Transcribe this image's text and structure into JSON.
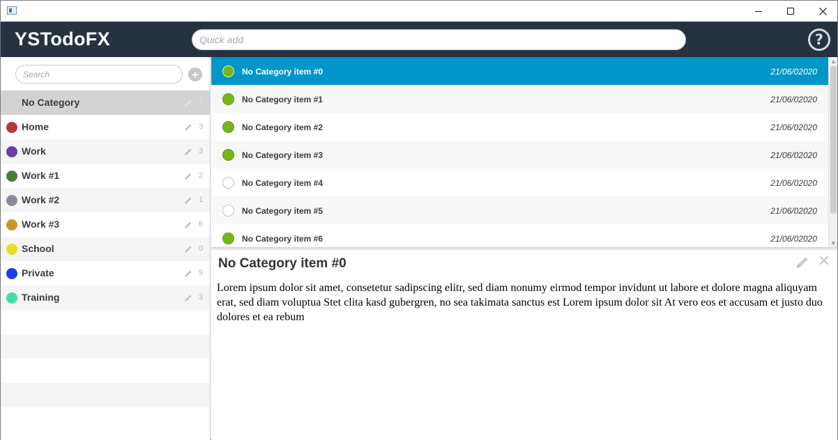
{
  "app": {
    "title": "YSTodoFX"
  },
  "quick_add": {
    "placeholder": "Quick add"
  },
  "help": {
    "label": "?"
  },
  "sidebar": {
    "search_placeholder": "Search",
    "add_label": "+",
    "categories": [
      {
        "label": "No Category",
        "count": "7",
        "color": "#d3d3d3",
        "selected": true
      },
      {
        "label": "Home",
        "count": "3",
        "color": "#b5393c"
      },
      {
        "label": "Work",
        "count": "3",
        "color": "#6a3fa8"
      },
      {
        "label": "Work #1",
        "count": "2",
        "color": "#4e7a3a"
      },
      {
        "label": "Work #2",
        "count": "1",
        "color": "#8c8a96"
      },
      {
        "label": "Work #3",
        "count": "6",
        "color": "#cf9426"
      },
      {
        "label": "School",
        "count": "0",
        "color": "#ecde1e"
      },
      {
        "label": "Private",
        "count": "9",
        "color": "#1a3fe6"
      },
      {
        "label": "Training",
        "count": "3",
        "color": "#3fe0a6"
      }
    ]
  },
  "tasks": {
    "items": [
      {
        "title": "No Category item #0",
        "date": "21/06/02020",
        "done": true,
        "selected": true
      },
      {
        "title": "No Category item #1",
        "date": "21/06/02020",
        "done": true
      },
      {
        "title": "No Category item #2",
        "date": "21/06/02020",
        "done": true
      },
      {
        "title": "No Category item #3",
        "date": "21/06/02020",
        "done": true
      },
      {
        "title": "No Category item #4",
        "date": "21/06/02020",
        "done": false
      },
      {
        "title": "No Category item #5",
        "date": "21/06/02020",
        "done": false
      },
      {
        "title": "No Category item #6",
        "date": "21/06/02020",
        "done": true
      }
    ]
  },
  "detail": {
    "title": "No Category item #0",
    "description": "Lorem ipsum dolor sit amet, consetetur sadipscing elitr, sed diam nonumy eirmod tempor invidunt ut labore et dolore magna aliquyam erat, sed diam voluptua Stet clita kasd gubergren, no sea takimata sanctus est Lorem ipsum dolor sit At vero eos et accusam et justo duo dolores et ea rebum",
    "delete_label": "✕"
  },
  "colors": {
    "header": "#273241",
    "selection": "#0096c9",
    "done": "#74b816"
  }
}
